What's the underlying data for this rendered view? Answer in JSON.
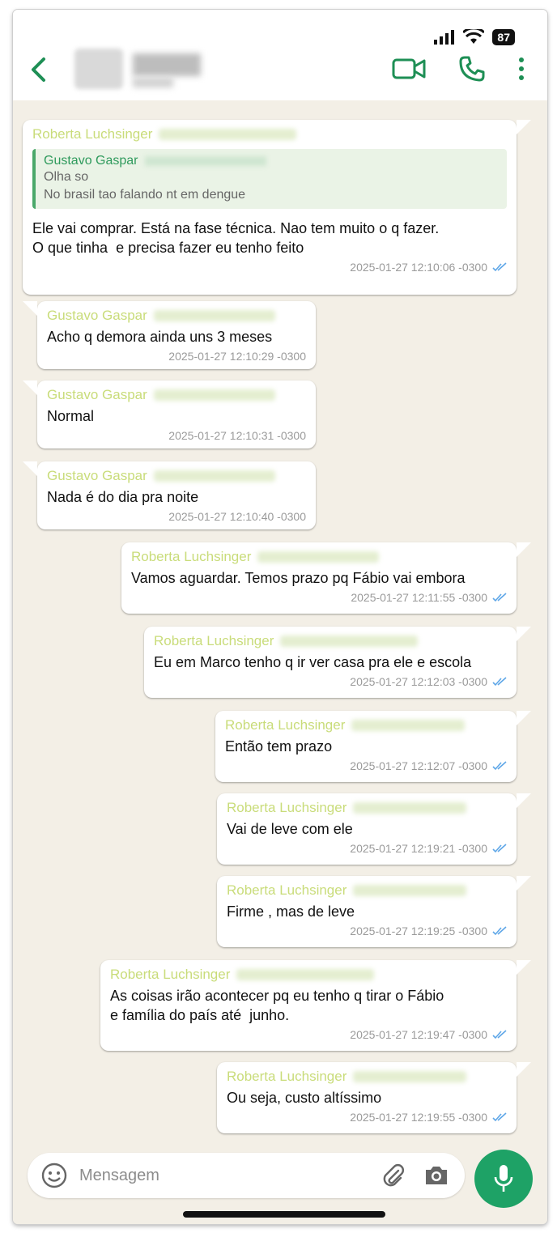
{
  "header": {
    "battery": "87",
    "contact_name": ""
  },
  "colors": {
    "accent": "#1ea266",
    "sender_name": "#c9dc7a",
    "quote_border": "#4aa86a",
    "chat_bg": "#f3efe6"
  },
  "icons": {
    "back": "chevron-left-icon",
    "video": "video-call-icon",
    "phone": "phone-icon",
    "menu": "more-vertical-icon",
    "emoji": "emoji-icon",
    "attach": "paperclip-icon",
    "camera": "camera-icon",
    "mic": "microphone-icon"
  },
  "messages": [
    {
      "sender": "Roberta Luchsinger",
      "quote": {
        "sender": "Gustavo Gaspar",
        "lines": [
          "Olha so",
          "No brasil tao falando nt em dengue"
        ]
      },
      "text": "Ele vai comprar. Está na fase técnica. Nao tem muito o q fazer.\nO que tinha  e precisa fazer eu tenho feito",
      "time": "2025-01-27 12:10:06 -0300"
    },
    {
      "sender": "Gustavo Gaspar",
      "text": "Acho q demora ainda uns 3 meses",
      "time": "2025-01-27 12:10:29 -0300"
    },
    {
      "sender": "Gustavo Gaspar",
      "text": "Normal",
      "time": "2025-01-27 12:10:31 -0300"
    },
    {
      "sender": "Gustavo Gaspar",
      "text": "Nada é do dia pra noite",
      "time": "2025-01-27 12:10:40 -0300"
    },
    {
      "sender": "Roberta Luchsinger",
      "text": "Vamos aguardar. Temos prazo pq Fábio vai embora",
      "time": "2025-01-27 12:11:55 -0300"
    },
    {
      "sender": "Roberta Luchsinger",
      "text": "Eu em Marco tenho q ir ver casa pra ele e escola",
      "time": "2025-01-27 12:12:03 -0300"
    },
    {
      "sender": "Roberta Luchsinger",
      "text": "Então tem prazo",
      "time": "2025-01-27 12:12:07 -0300"
    },
    {
      "sender": "Roberta Luchsinger",
      "text": "Vai de leve com ele",
      "time": "2025-01-27 12:19:21 -0300"
    },
    {
      "sender": "Roberta Luchsinger",
      "text": "Firme , mas de leve",
      "time": "2025-01-27 12:19:25 -0300"
    },
    {
      "sender": "Roberta Luchsinger",
      "text": "As coisas irão acontecer pq eu tenho q tirar o Fábio\ne família do país até  junho.",
      "time": "2025-01-27 12:19:47 -0300"
    },
    {
      "sender": "Roberta Luchsinger",
      "text": "Ou seja, custo altíssimo",
      "time": "2025-01-27 12:19:55 -0300"
    }
  ],
  "composer": {
    "placeholder": "Mensagem"
  }
}
